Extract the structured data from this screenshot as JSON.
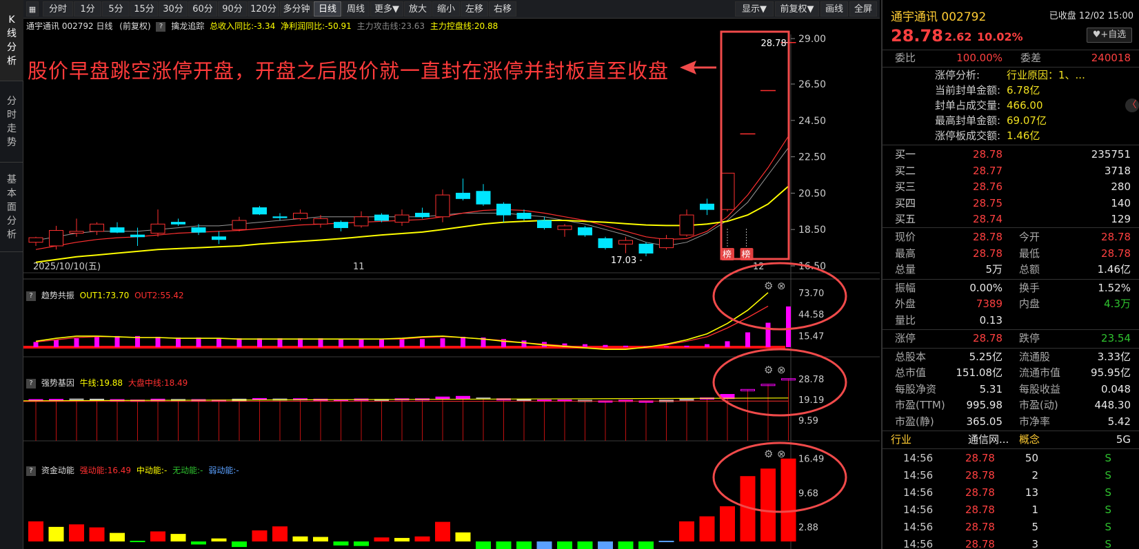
{
  "left_tabs": [
    {
      "label": "K线分析",
      "chars": [
        "K",
        "线",
        "分",
        "析"
      ]
    },
    {
      "label": "分时走势",
      "chars": [
        "分",
        "时",
        "走",
        "势"
      ]
    },
    {
      "label": "基本面分析",
      "chars": [
        "基",
        "本",
        "面",
        "分",
        "析"
      ]
    }
  ],
  "toolbar": {
    "items": [
      "分时",
      "1分",
      "5分",
      "15分",
      "30分",
      "60分",
      "90分",
      "120分",
      "多分钟",
      "日线",
      "周线",
      "更多▼",
      "放大",
      "缩小",
      "左移",
      "右移"
    ],
    "right_items": [
      "显示▼",
      "前复权▼",
      "画线",
      "全屏"
    ],
    "active": "日线"
  },
  "info": {
    "title": "通宇通讯 002792 日线",
    "adjust": "(前复权)",
    "indicator": "擒龙追踪",
    "f1": "总收入同比:-3.34",
    "f2": "净利润同比:-50.91",
    "f3": "主力攻击线:23.63",
    "f4": "主力控盘线:20.88"
  },
  "annotation": "股价早盘跳空涨停开盘，开盘之后股价就一直封在涨停并封板直至收盘",
  "main_labels": {
    "high_label": "28.78",
    "low_label": "17.03",
    "badge": "榜"
  },
  "date_labels": {
    "start": "2025/10/10(五)",
    "m11": "11",
    "m12": "12"
  },
  "panes": {
    "p1": {
      "name": "趋势共振",
      "a": "OUT1:73.70",
      "b": "OUT2:55.42"
    },
    "p2": {
      "name": "强势基因",
      "a": "牛线:19.88",
      "b": "大盘中线:18.49"
    },
    "p3": {
      "name": "资金动能",
      "a": "强动能:16.49",
      "b": "中动能:-",
      "c": "无动能:-",
      "d": "弱动能:-"
    }
  },
  "axes": {
    "main": [
      "29.00",
      "26.50",
      "24.50",
      "22.50",
      "20.50",
      "18.50",
      "16.50"
    ],
    "p1": [
      "73.70",
      "44.58",
      "15.47"
    ],
    "p2": [
      "28.78",
      "19.19",
      "9.59"
    ],
    "p3": [
      "16.49",
      "9.68",
      "2.88"
    ]
  },
  "chart_data": {
    "type": "candlestick",
    "title": "",
    "x_labels": [
      "2025/10/10(五)",
      "11",
      "12"
    ],
    "ylim": [
      16.5,
      29.0
    ],
    "candles": [
      {
        "o": 17.8,
        "h": 18.1,
        "l": 17.6,
        "c": 18.05
      },
      {
        "o": 17.6,
        "h": 18.7,
        "l": 17.4,
        "c": 18.45
      },
      {
        "o": 18.3,
        "h": 19.1,
        "l": 18.1,
        "c": 18.4
      },
      {
        "o": 18.4,
        "h": 18.9,
        "l": 18.2,
        "c": 18.8
      },
      {
        "o": 18.6,
        "h": 18.9,
        "l": 18.3,
        "c": 18.35
      },
      {
        "o": 18.2,
        "h": 18.6,
        "l": 17.6,
        "c": 18.1
      },
      {
        "o": 18.3,
        "h": 19.6,
        "l": 18.1,
        "c": 18.8
      },
      {
        "o": 18.9,
        "h": 19.1,
        "l": 18.7,
        "c": 18.8
      },
      {
        "o": 18.6,
        "h": 18.8,
        "l": 18.2,
        "c": 18.35
      },
      {
        "o": 18.1,
        "h": 18.4,
        "l": 17.7,
        "c": 17.95
      },
      {
        "o": 18.5,
        "h": 19.2,
        "l": 18.4,
        "c": 19.0
      },
      {
        "o": 19.7,
        "h": 19.8,
        "l": 19.3,
        "c": 19.35
      },
      {
        "o": 19.2,
        "h": 19.4,
        "l": 19.0,
        "c": 19.15
      },
      {
        "o": 19.1,
        "h": 19.6,
        "l": 19.0,
        "c": 19.4
      },
      {
        "o": 18.8,
        "h": 19.3,
        "l": 18.6,
        "c": 19.1
      },
      {
        "o": 18.9,
        "h": 19.0,
        "l": 18.4,
        "c": 18.6
      },
      {
        "o": 18.7,
        "h": 19.5,
        "l": 18.6,
        "c": 19.2
      },
      {
        "o": 19.3,
        "h": 19.4,
        "l": 18.9,
        "c": 19.0
      },
      {
        "o": 18.9,
        "h": 19.6,
        "l": 18.7,
        "c": 19.3
      },
      {
        "o": 19.4,
        "h": 19.7,
        "l": 19.1,
        "c": 19.2
      },
      {
        "o": 19.2,
        "h": 20.7,
        "l": 18.9,
        "c": 20.4
      },
      {
        "o": 20.5,
        "h": 21.3,
        "l": 20.1,
        "c": 20.2
      },
      {
        "o": 20.6,
        "h": 21.0,
        "l": 19.8,
        "c": 19.9
      },
      {
        "o": 19.9,
        "h": 20.0,
        "l": 18.9,
        "c": 19.3
      },
      {
        "o": 19.4,
        "h": 19.6,
        "l": 19.0,
        "c": 19.1
      },
      {
        "o": 19.0,
        "h": 19.2,
        "l": 18.5,
        "c": 18.6
      },
      {
        "o": 18.5,
        "h": 18.8,
        "l": 18.1,
        "c": 18.7
      },
      {
        "o": 18.6,
        "h": 18.7,
        "l": 18.1,
        "c": 18.2
      },
      {
        "o": 18.0,
        "h": 18.1,
        "l": 17.4,
        "c": 17.5
      },
      {
        "o": 17.7,
        "h": 18.1,
        "l": 17.2,
        "c": 17.9
      },
      {
        "o": 17.7,
        "h": 17.8,
        "l": 17.03,
        "c": 17.2
      },
      {
        "o": 17.5,
        "h": 18.2,
        "l": 17.4,
        "c": 18.0
      },
      {
        "o": 18.2,
        "h": 19.6,
        "l": 18.1,
        "c": 19.3
      },
      {
        "o": 19.9,
        "h": 20.2,
        "l": 19.3,
        "c": 19.6
      },
      {
        "o": 19.6,
        "h": 21.6,
        "l": 19.5,
        "c": 21.6
      },
      {
        "o": 23.76,
        "h": 23.76,
        "l": 23.76,
        "c": 23.76
      },
      {
        "o": 26.14,
        "h": 26.14,
        "l": 26.14,
        "c": 26.14
      },
      {
        "o": 28.78,
        "h": 28.78,
        "l": 28.78,
        "c": 28.78
      }
    ],
    "ma_yellow": [
      16.7,
      16.85,
      17.0,
      17.1,
      17.2,
      17.3,
      17.4,
      17.45,
      17.5,
      17.55,
      17.6,
      17.7,
      17.78,
      17.85,
      17.92,
      18.0,
      18.1,
      18.2,
      18.28,
      18.36,
      18.5,
      18.65,
      18.8,
      18.9,
      18.95,
      19.0,
      19.0,
      18.95,
      18.9,
      18.82,
      18.75,
      18.72,
      18.72,
      18.8,
      18.95,
      19.3,
      19.9,
      20.88
    ],
    "ma_red": [
      17.4,
      17.6,
      17.8,
      17.95,
      18.05,
      18.1,
      18.2,
      18.3,
      18.35,
      18.4,
      18.45,
      18.55,
      18.65,
      18.75,
      18.8,
      18.85,
      18.9,
      18.95,
      19.0,
      19.05,
      19.2,
      19.4,
      19.55,
      19.6,
      19.55,
      19.4,
      19.2,
      19.0,
      18.7,
      18.4,
      18.1,
      17.95,
      18.0,
      18.4,
      19.2,
      20.4,
      21.9,
      23.63
    ],
    "ma_gray": [
      17.9,
      18.1,
      18.3,
      18.4,
      18.4,
      18.4,
      18.5,
      18.6,
      18.7,
      18.7,
      18.8,
      18.9,
      19.0,
      19.1,
      19.2,
      19.2,
      19.2,
      19.2,
      19.2,
      19.2,
      19.3,
      19.4,
      19.4,
      19.4,
      19.3,
      19.2,
      19.0,
      18.8,
      18.5,
      18.2,
      17.8,
      17.6,
      17.8,
      18.3,
      19.0,
      20.0,
      21.5,
      23.0
    ],
    "p1": {
      "ylim": [
        0,
        80
      ],
      "bars": [
        7,
        10,
        12,
        14,
        15,
        15,
        14,
        13,
        13,
        12,
        12,
        12,
        12,
        12,
        12,
        11,
        11,
        11,
        11,
        11,
        12,
        14,
        13,
        11,
        9,
        7,
        5,
        4,
        3,
        2,
        1,
        1,
        2,
        4,
        8,
        20,
        33,
        55,
        73.7
      ],
      "out1": [
        8,
        12,
        15,
        15,
        14,
        13,
        13,
        12,
        12,
        12,
        11,
        11,
        11,
        11,
        11,
        11,
        11,
        11,
        12,
        14,
        15,
        13,
        11,
        8,
        6,
        3,
        1,
        -1,
        -3,
        -3,
        0,
        4,
        10,
        18,
        32,
        50,
        73.7
      ],
      "out2": [
        7,
        10,
        13,
        14,
        14,
        13,
        13,
        12,
        12,
        12,
        11,
        11,
        11,
        11,
        11,
        11,
        11,
        11,
        11,
        13,
        14,
        13,
        11,
        9,
        6,
        4,
        2,
        0,
        -2,
        -2,
        0,
        3,
        8,
        14,
        26,
        40,
        55.42
      ]
    },
    "p2": {
      "ylim": [
        0,
        32
      ],
      "bull": 19.88,
      "mid": 18.49,
      "bars": [
        [
          18.6,
          19.2
        ],
        [
          18.8,
          19.3
        ],
        [
          18.9,
          19.5
        ],
        [
          18.8,
          19.4
        ],
        [
          18.5,
          19.2
        ],
        [
          18.4,
          19.0
        ],
        [
          18.6,
          19.4
        ],
        [
          18.7,
          19.3
        ],
        [
          18.5,
          19.2
        ],
        [
          18.4,
          19.0
        ],
        [
          18.5,
          19.4
        ],
        [
          19.1,
          19.7
        ],
        [
          19.0,
          19.5
        ],
        [
          19.0,
          19.6
        ],
        [
          18.9,
          19.4
        ],
        [
          18.7,
          19.2
        ],
        [
          18.8,
          19.5
        ],
        [
          18.9,
          19.3
        ],
        [
          19.0,
          19.6
        ],
        [
          19.1,
          19.6
        ],
        [
          19.3,
          20.4
        ],
        [
          19.6,
          20.7
        ],
        [
          19.4,
          20.0
        ],
        [
          19.0,
          19.6
        ],
        [
          18.9,
          19.4
        ],
        [
          18.7,
          19.0
        ],
        [
          18.6,
          19.0
        ],
        [
          18.4,
          18.9
        ],
        [
          18.1,
          18.6
        ],
        [
          18.3,
          18.9
        ],
        [
          17.9,
          18.6
        ],
        [
          18.2,
          18.9
        ],
        [
          18.8,
          19.7
        ],
        [
          19.4,
          20.0
        ],
        [
          19.6,
          21.6
        ],
        [
          23.7,
          23.9
        ],
        [
          26.1,
          26.3
        ],
        [
          28.7,
          28.9
        ]
      ]
    },
    "p3": {
      "ylim": [
        -1.5,
        17
      ],
      "bars": [
        4.0,
        2.9,
        3.4,
        2.8,
        1.7,
        0,
        2.0,
        1.5,
        -0.6,
        0.6,
        -1.1,
        2.2,
        3.0,
        1.0,
        0.9,
        -0.8,
        -0.9,
        0.8,
        0.7,
        1.0,
        3.9,
        1.8,
        -1.7,
        -1.6,
        -2.1,
        -1.7,
        -1.6,
        -2.2,
        -2.6,
        -1.6,
        -2.6,
        0,
        4.0,
        5.0,
        7.0,
        13.0,
        14.5,
        16.49
      ],
      "colors": [
        "#ff0000",
        "#ffff00",
        "#ff0000",
        "#ff0000",
        "#ffff00",
        "#00ff00",
        "#ff0000",
        "#ffff00",
        "#00ff00",
        "#ffff00",
        "#00ff00",
        "#ff0000",
        "#ff0000",
        "#ffff00",
        "#ffff00",
        "#00ff00",
        "#00ff00",
        "#ff0000",
        "#ffff00",
        "#ff0000",
        "#ff0000",
        "#ffff00",
        "#00ff00",
        "#00ff00",
        "#00ff00",
        "#5aa0ff",
        "#00ff00",
        "#00ff00",
        "#5aa0ff",
        "#00ff00",
        "#00ff00",
        "#5aa0ff",
        "#ff0000",
        "#ff0000",
        "#ff0000",
        "#ff0000",
        "#ff0000",
        "#ff0000"
      ]
    }
  },
  "colors": {
    "up": "#ff3030",
    "down": "#00e5ff",
    "ma_yellow": "#ffff00",
    "ma_red": "#ff3030",
    "magenta": "#ff00ff",
    "annotation": "#ff3b3b",
    "circle": "#f04a4a"
  },
  "quote": {
    "name": "通宇通讯 002792",
    "status": "已收盘 12/02 15:00",
    "price": "28.78",
    "change": "2.62",
    "pct": "10.02%",
    "add": "♥+自选",
    "weibi_label": "委比",
    "weibi": "100.00%",
    "weicha_label": "委差",
    "weicha": "240018",
    "zt": [
      {
        "k": "涨停分析:",
        "v": "行业原因：1、..."
      },
      {
        "k": "当前封单金额:",
        "v": "6.78亿"
      },
      {
        "k": "封单占成交量:",
        "v": "466.00"
      },
      {
        "k": "最高封单金额:",
        "v": "69.07亿"
      },
      {
        "k": "涨停板成交额:",
        "v": "1.46亿"
      }
    ],
    "book": [
      {
        "l": "买一",
        "p": "28.78",
        "v": "235751"
      },
      {
        "l": "买二",
        "p": "28.77",
        "v": "3718"
      },
      {
        "l": "买三",
        "p": "28.76",
        "v": "280"
      },
      {
        "l": "买四",
        "p": "28.75",
        "v": "140"
      },
      {
        "l": "买五",
        "p": "28.74",
        "v": "129"
      }
    ],
    "stats1": [
      {
        "l1": "现价",
        "v1": "28.78",
        "c1": "red",
        "l2": "今开",
        "v2": "28.78",
        "c2": "red"
      },
      {
        "l1": "最高",
        "v1": "28.78",
        "c1": "red",
        "l2": "最低",
        "v2": "28.78",
        "c2": "red"
      },
      {
        "l1": "总量",
        "v1": "5万",
        "c1": "white",
        "l2": "总额",
        "v2": "1.46亿",
        "c2": "white"
      }
    ],
    "stats2": [
      {
        "l1": "振幅",
        "v1": "0.00%",
        "c1": "white",
        "l2": "换手",
        "v2": "1.52%",
        "c2": "white"
      },
      {
        "l1": "外盘",
        "v1": "7389",
        "c1": "red",
        "l2": "内盘",
        "v2": "4.3万",
        "c2": "green"
      },
      {
        "l1": "量比",
        "v1": "0.13",
        "c1": "white",
        "l2": "",
        "v2": "",
        "c2": "white"
      }
    ],
    "stats3": [
      {
        "l1": "涨停",
        "v1": "28.78",
        "c1": "red",
        "l2": "跌停",
        "v2": "23.54",
        "c2": "green"
      }
    ],
    "stats4": [
      {
        "l1": "总股本",
        "v1": "5.25亿",
        "c1": "white",
        "l2": "流通股",
        "v2": "3.33亿",
        "c2": "white"
      },
      {
        "l1": "总市值",
        "v1": "151.08亿",
        "c1": "white",
        "l2": "流通市值",
        "v2": "95.95亿",
        "c2": "white"
      },
      {
        "l1": "每股净资",
        "v1": "5.31",
        "c1": "white",
        "l2": "每股收益",
        "v2": "0.048",
        "c2": "white"
      },
      {
        "l1": "市盈(TTM)",
        "v1": "995.98",
        "c1": "white",
        "l2": "市盈(动)",
        "v2": "448.30",
        "c2": "white"
      },
      {
        "l1": "市盈(静)",
        "v1": "365.05",
        "c1": "white",
        "l2": "市净率",
        "v2": "5.42",
        "c2": "white"
      }
    ],
    "industry": {
      "l1": "行业",
      "v1": "通信网...",
      "l2": "概念",
      "v2": "5G"
    },
    "ticks": [
      {
        "t": "14:56",
        "p": "28.78",
        "v": "50",
        "s": "S"
      },
      {
        "t": "14:56",
        "p": "28.78",
        "v": "2",
        "s": "S"
      },
      {
        "t": "14:56",
        "p": "28.78",
        "v": "13",
        "s": "S"
      },
      {
        "t": "14:56",
        "p": "28.78",
        "v": "1",
        "s": "S"
      },
      {
        "t": "14:56",
        "p": "28.78",
        "v": "5",
        "s": "S"
      },
      {
        "t": "14:56",
        "p": "28.78",
        "v": "3",
        "s": "S"
      }
    ]
  }
}
